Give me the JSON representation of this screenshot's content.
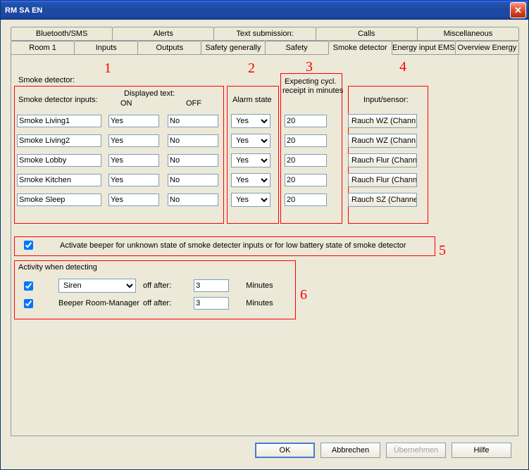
{
  "window": {
    "title": "RM SA EN"
  },
  "tabs": {
    "row1": [
      "Bluetooth/SMS",
      "Alerts",
      "Text submission:",
      "Calls",
      "Miscellaneous"
    ],
    "row2": [
      "Room 1",
      "Inputs",
      "Outputs",
      "Safety generally",
      "Safety",
      "Smoke detector",
      "Energy input EMS",
      "Overview Energy"
    ],
    "active": "Smoke detector"
  },
  "annotations": {
    "n1": "1",
    "n2": "2",
    "n3": "3",
    "n4": "4",
    "n5": "5",
    "n6": "6"
  },
  "section": {
    "title": "Smoke detector:",
    "col_inputs": "Smoke detector inputs:",
    "col_disp": "Displayed text:",
    "col_on": "ON",
    "col_off": "OFF",
    "col_alarm": "Alarm state",
    "col_cycl1": "Expecting cycl.",
    "col_cycl2": "receipt in minutes",
    "col_sensor": "Input/sensor:"
  },
  "rows": [
    {
      "name": "Smoke Living1",
      "on": "Yes",
      "off": "No",
      "alarm": "Yes",
      "cycl": "20",
      "sensor": "Rauch WZ  (Chann"
    },
    {
      "name": "Smoke Living2",
      "on": "Yes",
      "off": "No",
      "alarm": "Yes",
      "cycl": "20",
      "sensor": "Rauch WZ  (Chann"
    },
    {
      "name": "Smoke Lobby",
      "on": "Yes",
      "off": "No",
      "alarm": "Yes",
      "cycl": "20",
      "sensor": "Rauch Flur  (Channe"
    },
    {
      "name": "Smoke Kitchen",
      "on": "Yes",
      "off": "No",
      "alarm": "Yes",
      "cycl": "20",
      "sensor": "Rauch Flur  (Channe"
    },
    {
      "name": "Smoke Sleep",
      "on": "Yes",
      "off": "No",
      "alarm": "Yes",
      "cycl": "20",
      "sensor": "Rauch SZ  (Channel"
    }
  ],
  "beeper": {
    "label": "Activate beeper for unknown state of smoke detecter inputs or for low battery state of smoke detector"
  },
  "activity": {
    "title": "Activity when detecting",
    "siren": "Siren",
    "brm": "Beeper Room-Manager",
    "offafter": "off after:",
    "minutes": "Minutes",
    "val_siren": "3",
    "val_brm": "3"
  },
  "buttons": {
    "ok": "OK",
    "cancel": "Abbrechen",
    "apply": "Übernehmen",
    "help": "Hilfe"
  }
}
